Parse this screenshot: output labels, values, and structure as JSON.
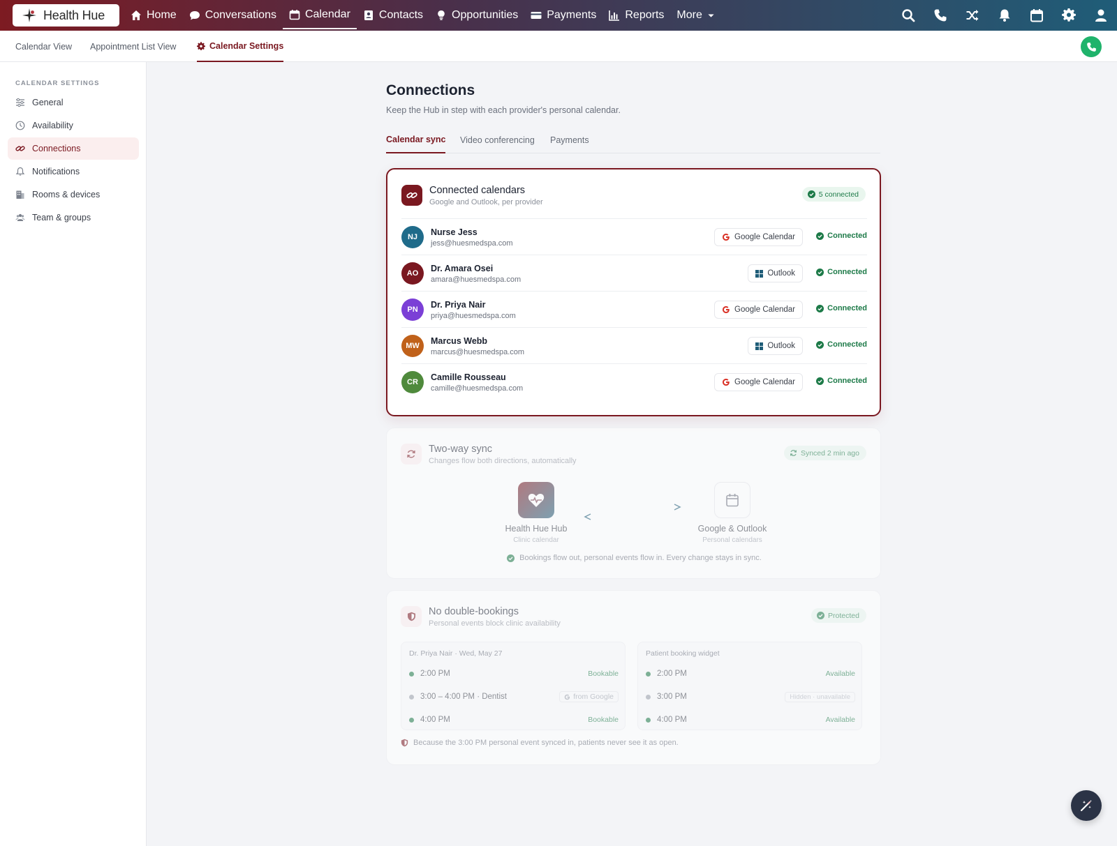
{
  "app": {
    "name": "Health Hue"
  },
  "nav": {
    "items": [
      {
        "label": "Home",
        "icon": "home-icon"
      },
      {
        "label": "Conversations",
        "icon": "chat-icon"
      },
      {
        "label": "Calendar",
        "icon": "calendar-icon",
        "active": true
      },
      {
        "label": "Contacts",
        "icon": "contacts-icon"
      },
      {
        "label": "Opportunities",
        "icon": "lightbulb-icon"
      },
      {
        "label": "Payments",
        "icon": "credit-card-icon"
      },
      {
        "label": "Reports",
        "icon": "bar-chart-icon"
      },
      {
        "label": "More",
        "icon": "chevron-down-icon"
      }
    ],
    "right_icons": [
      "search-icon",
      "phone-icon",
      "shuffle-icon",
      "bell-icon",
      "calendar-icon",
      "gear-icon",
      "user-icon"
    ]
  },
  "subnav": {
    "tabs": [
      "Calendar View",
      "Appointment List View",
      "Calendar Settings"
    ],
    "active": "Calendar Settings"
  },
  "sidebar": {
    "title": "CALENDAR SETTINGS",
    "items": [
      {
        "label": "General",
        "icon": "sliders-icon"
      },
      {
        "label": "Availability",
        "icon": "clock-icon"
      },
      {
        "label": "Connections",
        "icon": "link-icon",
        "active": true
      },
      {
        "label": "Notifications",
        "icon": "bell-icon"
      },
      {
        "label": "Rooms & devices",
        "icon": "building-icon"
      },
      {
        "label": "Team & groups",
        "icon": "users-icon"
      }
    ]
  },
  "page": {
    "title": "Connections",
    "subtitle": "Keep the Hub in step with each provider's personal calendar.",
    "tabs": [
      "Calendar sync",
      "Video conferencing",
      "Payments"
    ],
    "active_tab": "Calendar sync"
  },
  "connected_calendars": {
    "title": "Connected calendars",
    "subtitle": "Google and Outlook, per provider",
    "badge": "5 connected",
    "providers": [
      {
        "initials": "NJ",
        "name": "Nurse Jess",
        "email": "jess@huesmedspa.com",
        "calendar": "Google Calendar",
        "status": "Connected",
        "color": "#1f6b8a"
      },
      {
        "initials": "AO",
        "name": "Dr. Amara Osei",
        "email": "amara@huesmedspa.com",
        "calendar": "Outlook",
        "status": "Connected",
        "color": "#7a1820"
      },
      {
        "initials": "PN",
        "name": "Dr. Priya Nair",
        "email": "priya@huesmedspa.com",
        "calendar": "Google Calendar",
        "status": "Connected",
        "color": "#7b3fd6"
      },
      {
        "initials": "MW",
        "name": "Marcus Webb",
        "email": "marcus@huesmedspa.com",
        "calendar": "Outlook",
        "status": "Connected",
        "color": "#c0611a"
      },
      {
        "initials": "CR",
        "name": "Camille Rousseau",
        "email": "camille@huesmedspa.com",
        "calendar": "Google Calendar",
        "status": "Connected",
        "color": "#4f8a3c"
      }
    ]
  },
  "two_way_sync": {
    "title": "Two-way sync",
    "subtitle": "Changes flow both directions, automatically",
    "badge": "Synced 2 min ago",
    "hub_label": "Health Hue Hub",
    "hub_sub": "Clinic calendar",
    "ext_label": "Google & Outlook",
    "ext_sub": "Personal calendars",
    "note": "Bookings flow out, personal events flow in. Every change stays in sync."
  },
  "double_bookings": {
    "title": "No double-bookings",
    "subtitle": "Personal events block clinic availability",
    "badge": "Protected",
    "left_head": "Dr. Priya Nair · Wed, May 27",
    "right_head": "Patient booking widget",
    "left_slots": [
      {
        "time": "2:00 PM",
        "tag": "Bookable"
      },
      {
        "time": "3:00 – 4:00 PM · Dentist",
        "tag": "from Google"
      },
      {
        "time": "4:00 PM",
        "tag": "Bookable"
      }
    ],
    "right_slots": [
      {
        "time": "2:00 PM",
        "tag": "Available"
      },
      {
        "time": "3:00 PM",
        "tag": "Hidden · unavailable"
      },
      {
        "time": "4:00 PM",
        "tag": "Available"
      }
    ],
    "note": "Because the 3:00 PM personal event synced in, patients never see it as open."
  },
  "colors": {
    "brand": "#7a1820",
    "success": "#1d7a48",
    "teal": "#1f5d78"
  }
}
